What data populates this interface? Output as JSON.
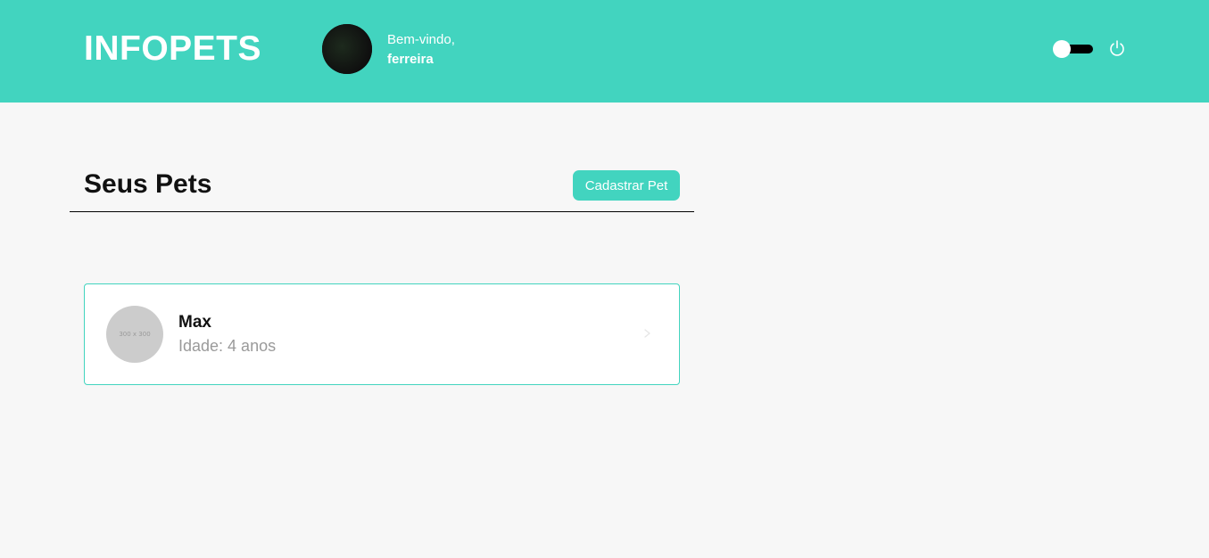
{
  "header": {
    "logo": "INFOPETS",
    "welcome_text": "Bem-vindo,",
    "username": "ferreira",
    "avatar_icon": "user-avatar",
    "theme_toggle_icon": "toggle-switch-icon",
    "logout_icon": "power-icon"
  },
  "main": {
    "title": "Seus Pets",
    "add_button_label": "Cadastrar Pet",
    "pets": [
      {
        "name": "Max",
        "age_text": "Idade: 4 anos",
        "photo_placeholder": "300 x 300",
        "chevron_icon": "chevron-right-icon"
      }
    ]
  },
  "colors": {
    "brand": "#42d4bf",
    "background": "#f7f7f7",
    "card": "#ffffff",
    "muted_text": "#9a9a9a"
  }
}
